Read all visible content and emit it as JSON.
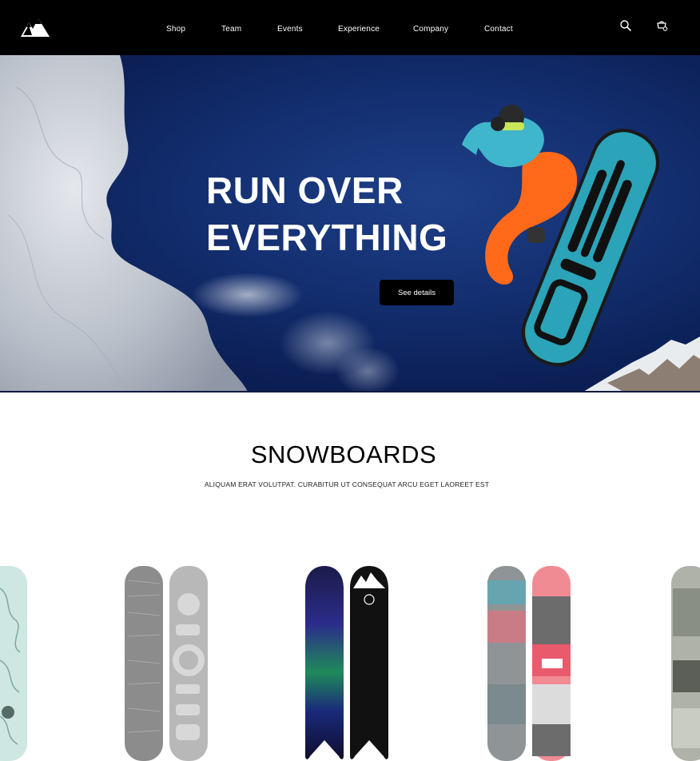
{
  "header": {
    "logo_icon": "mountain-logo-icon",
    "nav": [
      "Shop",
      "Team",
      "Events",
      "Experience",
      "Company",
      "Contact"
    ],
    "search_icon": "search-icon",
    "cart_icon": "cart-icon"
  },
  "hero": {
    "title_line1": "RUN OVER",
    "title_line2": "EVERYTHING",
    "button_label": "See details"
  },
  "section": {
    "title": "SNOWBOARDS",
    "subtitle": "ALIQUAM ERAT VOLUTPAT. CURABITUR UT CONSEQUAT ARCU EGET LAOREET EST"
  },
  "products": [
    {
      "name": "mint-pattern-snowboard"
    },
    {
      "name": "grey-burton-snowboard-pair"
    },
    {
      "name": "galaxy-black-snowboard-pair"
    },
    {
      "name": "custom-pink-snowboard-pair"
    },
    {
      "name": "grey-graphic-snowboard"
    }
  ],
  "colors": {
    "header_bg": "#000000",
    "hero_sky": "#143072",
    "button_bg": "#000000",
    "board_teal": "#2ba3b8",
    "pants_orange": "#ff6a1a"
  }
}
